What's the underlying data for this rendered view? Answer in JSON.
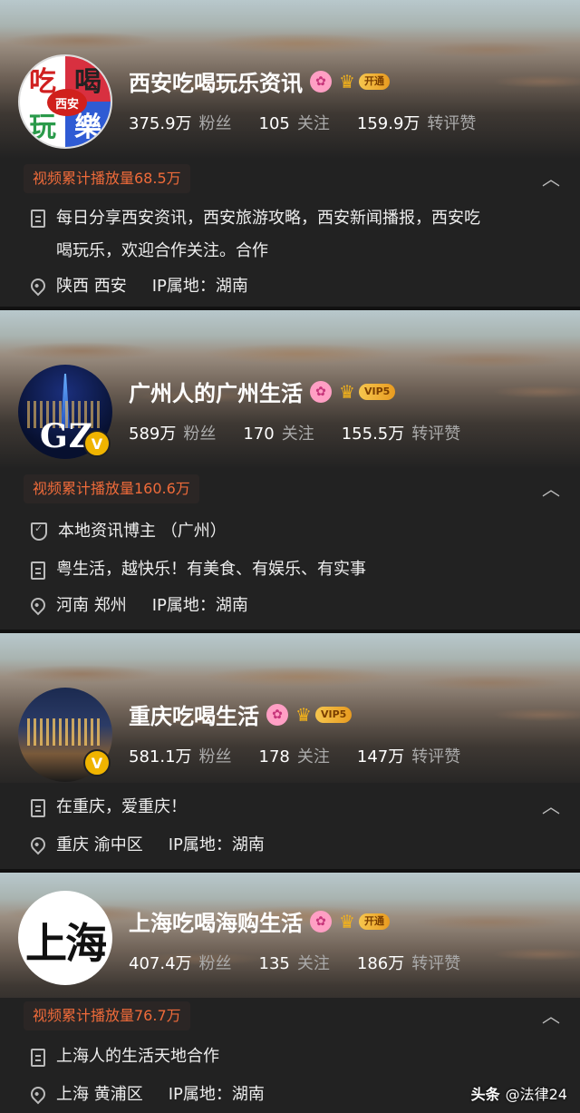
{
  "cards": [
    {
      "name": "西安吃喝玩乐资讯",
      "avatar_chars": [
        "吃",
        "喝",
        "玩",
        "樂"
      ],
      "avatar_center": "西安",
      "vip_label": "开通",
      "stats": [
        {
          "num": "375.9万",
          "label": "粉丝"
        },
        {
          "num": "105",
          "label": "关注"
        },
        {
          "num": "159.9万",
          "label": "转评赞"
        }
      ],
      "play_count": "视频累计播放量68.5万",
      "bio_line1": "每日分享西安资讯，西安旅游攻略，西安新闻播报，西安吃",
      "bio_line2": "喝玩乐，欢迎合作关注。合作",
      "location": "陕西 西安",
      "ip": "IP属地：湖南"
    },
    {
      "name": "广州人的广州生活",
      "avatar_text": "GZ",
      "vip_label": "VIP5",
      "stats": [
        {
          "num": "589万",
          "label": "粉丝"
        },
        {
          "num": "170",
          "label": "关注"
        },
        {
          "num": "155.5万",
          "label": "转评赞"
        }
      ],
      "play_count": "视频累计播放量160.6万",
      "role": "本地资讯博主 （广州）",
      "bio": "粤生活，越快乐！有美食、有娱乐、有实事",
      "location": "河南 郑州",
      "ip": "IP属地：湖南"
    },
    {
      "name": "重庆吃喝生活",
      "vip_label": "VIP5",
      "stats": [
        {
          "num": "581.1万",
          "label": "粉丝"
        },
        {
          "num": "178",
          "label": "关注"
        },
        {
          "num": "147万",
          "label": "转评赞"
        }
      ],
      "bio": "在重庆，爱重庆！",
      "location": "重庆 渝中区",
      "ip": "IP属地：湖南"
    },
    {
      "name": "上海吃喝海购生活",
      "avatar_text": "上海",
      "vip_label": "开通",
      "stats": [
        {
          "num": "407.4万",
          "label": "粉丝"
        },
        {
          "num": "135",
          "label": "关注"
        },
        {
          "num": "186万",
          "label": "转评赞"
        }
      ],
      "play_count": "视频累计播放量76.7万",
      "bio": "上海人的生活天地合作",
      "location": "上海 黄浦区",
      "ip": "IP属地：湖南"
    }
  ],
  "watermark": {
    "brand": "头条",
    "handle": "@法律24"
  },
  "icons": {
    "chevron": "chevron-up-icon",
    "doc": "document-icon",
    "pin": "location-pin-icon",
    "shield": "shield-check-icon",
    "verified": "verified-v-icon",
    "pink": "pink-badge-icon",
    "crown": "crown-icon"
  },
  "colors": {
    "play_count_text": "#ef6b3a",
    "vip_gold": "#f0b400",
    "panel_bg": "#222222"
  }
}
